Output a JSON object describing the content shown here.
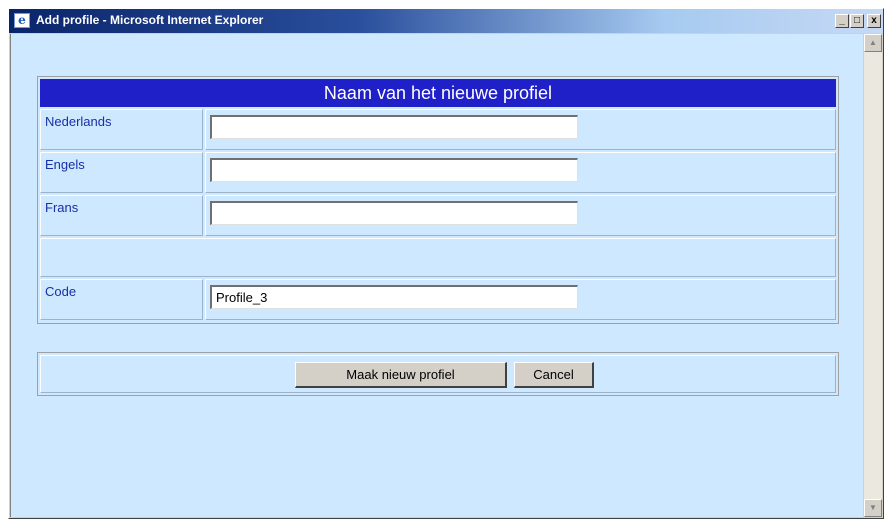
{
  "window": {
    "title": "Add profile - Microsoft Internet Explorer",
    "app_icon": "ie-icon"
  },
  "caption_buttons": {
    "minimize": "_",
    "maximize": "□",
    "close": "x"
  },
  "form": {
    "heading": "Naam van het nieuwe profiel",
    "fields": [
      {
        "label": "Nederlands",
        "value": ""
      },
      {
        "label": "Engels",
        "value": ""
      },
      {
        "label": "Frans",
        "value": ""
      }
    ],
    "code": {
      "label": "Code",
      "value": "Profile_3"
    }
  },
  "actions": {
    "create_label": "Maak nieuw profiel",
    "cancel_label": "Cancel"
  },
  "scrollbar": {
    "up": "▲",
    "down": "▼"
  },
  "colors": {
    "header_bg": "#2020c8",
    "content_bg": "#cde8ff",
    "label_text": "#1b2fa6"
  }
}
